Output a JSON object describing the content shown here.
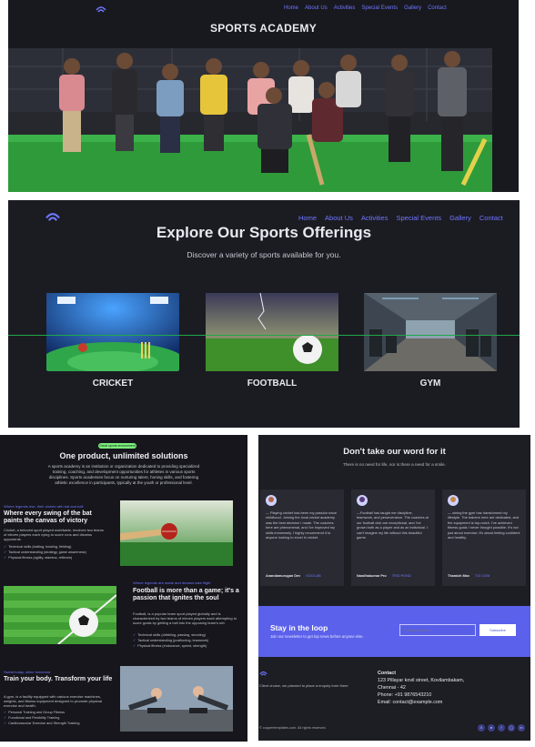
{
  "colors": {
    "accent": "#6f78ff",
    "panel_bg": "#1b1b21",
    "newsletter_bg": "#5b61ea",
    "check_green": "#7bf07b"
  },
  "nav": [
    "Home",
    "About Us",
    "Activities",
    "Special Events",
    "Gallery",
    "Contact"
  ],
  "hero": {
    "title": "SPORTS ACADEMY",
    "logo_icon": "academy-logo-icon",
    "photo": "group-photo-of-players-holding-cricket-bats"
  },
  "offerings": {
    "title": "Explore Our Sports Offerings",
    "subtitle": "Discover a variety of sports available for you.",
    "cards": [
      {
        "label": "CRICKET",
        "image": "cricket-stadium-image"
      },
      {
        "label": "FOOTBALL",
        "image": "football-on-grass-image"
      },
      {
        "label": "GYM",
        "image": "gym-interior-image"
      }
    ]
  },
  "features": {
    "badge": "Great sports environment",
    "title": "One product, unlimited solutions",
    "intro": "A sports academy is an institution or organization dedicated to providing specialized training, coaching, and development opportunities for athletes in various sports disciplines. Sports academies focus on nurturing talent, honing skills, and fostering athletic excellence in participants, typically at the youth or professional level.",
    "items": [
      {
        "tag": "Where legends rise, their stories with bat and ball",
        "heading": "Where every swing of the bat paints the canvas of victory",
        "desc": "Cricket, a beloved sport played worldwide, involves two teams of eleven players each vying to score runs and dismiss opponents.",
        "points": [
          "Technical skills (batting, bowling, fielding)",
          "Tactical understanding (strategy, game awareness)",
          "Physical fitness (agility, stamina, reflexes)"
        ],
        "image": "cricket-ball-and-bat-image"
      },
      {
        "tag": "Where legends are made and dreams take flight",
        "heading": "Football is more than a game; it's a passion that ignites the soul",
        "desc": "Football, is a popular team sport played globally and is characterized by two teams of eleven players each attempting to score goals by getting a ball into the opposing team's net.",
        "points": [
          "Technical skills (dribbling, passing, shooting)",
          "Tactical understanding (positioning, teamwork)",
          "Physical fitness (endurance, speed, strength)"
        ],
        "image": "football-on-field-image"
      },
      {
        "tag": "Sweat today, shine tomorrow",
        "heading": "Train your body. Transform your life",
        "desc": "A gym, is a facility equipped with various exercise machines, weights, and fitness equipment designed to promote physical exercise and health.",
        "points": [
          "Personal Training and Group Fitness",
          "Functional and Flexibility Training",
          "Cardiovascular Exercise and Strength Training"
        ],
        "image": "people-doing-pushups-image"
      }
    ]
  },
  "testimonials": {
    "title": "Don't take our word for it",
    "subtitle": "There is no need for life, nor is there a need for a smile.",
    "items": [
      {
        "quote": "— Playing cricket has been my passion since childhood. Joining the local cricket academy was the best decision I made. The coaches here are phenomenal, and I've improved my skills immensely. I highly recommend it to anyone looking to excel in cricket.",
        "name": "Anandamurugan Dev",
        "company": "SOCILAB",
        "avatar": "avatar-icon"
      },
      {
        "quote": "—Football has taught me discipline, teamwork, and perseverance. The coaches at our football club are exceptional, and I've grown both as a player and as an individual. I can't imagine my life without this beautiful game.",
        "name": "Nandhakumar Pro",
        "company": "TRID POND",
        "avatar": "avatar-icon"
      },
      {
        "quote": "— oining the gym has transformed my lifestyle. The trainers here are dedicated, and the equipment is top-notch. I've achieved fitness goals I never thought possible. It's not just about exercise; it's about feeling confident and healthy.",
        "name": "Thamizh Max",
        "company": "T10 COM",
        "avatar": "avatar-icon"
      }
    ]
  },
  "newsletter": {
    "title": "Stay in the loop",
    "subtitle": "Join our newsletter to get top news before anyone else.",
    "placeholder": "Your best email...",
    "button": "Subscribe"
  },
  "footer": {
    "desc": "Client choice, we planned to place a enquiry form there",
    "contact_title": "Contact",
    "address1": "123 Pillayar kovil street, Kovilambakam,",
    "address2": "Chennai - 42",
    "phone": "Phone: +91 9876543210",
    "email": "Email: contact@example.com",
    "copyright": "© coppertemplates.com. All rights reserved.",
    "social": [
      "x-icon",
      "github-icon",
      "facebook-icon",
      "instagram-icon",
      "linkedin-icon"
    ]
  }
}
